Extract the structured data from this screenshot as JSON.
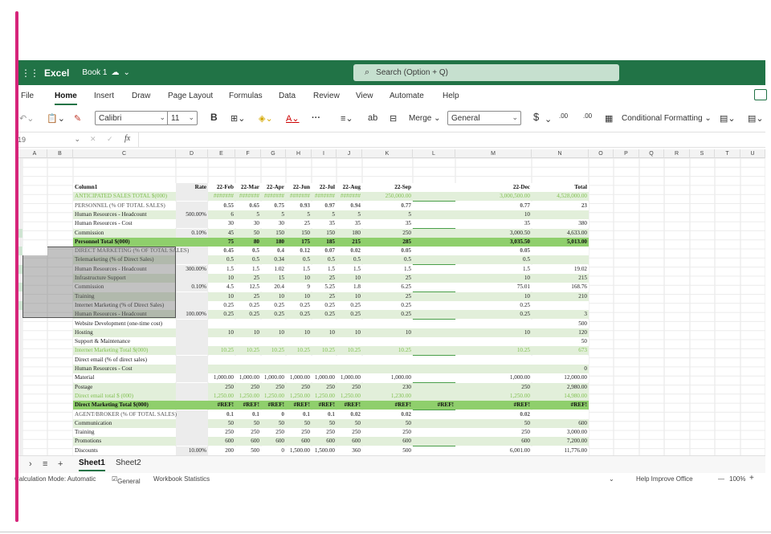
{
  "app": {
    "name": "Excel",
    "book": "Book 1"
  },
  "search": {
    "placeholder": "Search (Option + Q)"
  },
  "menu": [
    "File",
    "Home",
    "Insert",
    "Draw",
    "Page Layout",
    "Formulas",
    "Data",
    "Review",
    "View",
    "Automate",
    "Help"
  ],
  "toolbar": {
    "font": "Calibri",
    "size": "11",
    "bold": "B",
    "font_color": "A",
    "more": "···",
    "merge": "Merge",
    "number_format": "General",
    "currency": "$",
    "dec_inc": ".00",
    "dec_dec": ".00",
    "cond_format": "Conditional Formatting"
  },
  "formula_bar": {
    "namebox": "19",
    "cancel": "✕",
    "confirm": "✓",
    "fx": "fx"
  },
  "columns": [
    "A",
    "B",
    "C",
    "D",
    "E",
    "F",
    "G",
    "H",
    "I",
    "J",
    "K",
    "L",
    "M",
    "N",
    "O",
    "P",
    "Q",
    "R",
    "S",
    "T",
    "U"
  ],
  "rows": [
    {
      "c": "Column1",
      "d": "Rate",
      "e": "22-Feb",
      "f": "22-Mar",
      "g": "22-Apr",
      "h": "22-Jun",
      "i": "22-Jul",
      "j": "22-Aug",
      "k": "22-Sep",
      "m": "22-Dec",
      "n": "Total",
      "style": "header"
    },
    {
      "c": "ANTICIPATED SALES TOTAL $(000)",
      "e": "#######",
      "f": "#######",
      "g": "#######",
      "h": "#######",
      "i": "#######",
      "j": "#######",
      "k": "250,000.00",
      "m": "3,000,500.00",
      "n": "4,528,000.00",
      "style": "greentext"
    },
    {
      "c": "PERSONNEL (% OF TOTAL SALES)",
      "e": "0.55",
      "f": "0.65",
      "g": "0.75",
      "h": "0.93",
      "i": "0.97",
      "j": "0.94",
      "k": "0.77",
      "m": "0.77",
      "n": "23",
      "style": "boldnum"
    },
    {
      "c": "Human Resources - Headcount",
      "d": "500.00%",
      "e": "6",
      "f": "5",
      "g": "5",
      "h": "5",
      "i": "5",
      "j": "5",
      "k": "5",
      "m": "10",
      "n": "",
      "style": "light"
    },
    {
      "c": "Human Resources - Cost",
      "e": "30",
      "f": "30",
      "g": "30",
      "h": "25",
      "i": "35",
      "j": "35",
      "k": "35",
      "m": "35",
      "n": "380",
      "style": "plain"
    },
    {
      "c": "Commission",
      "d": "0.10%",
      "e": "45",
      "f": "50",
      "g": "150",
      "h": "150",
      "i": "150",
      "j": "180",
      "k": "250",
      "m": "3,000.50",
      "n": "4,633.00",
      "style": "light"
    },
    {
      "c": "Personnel Total $(000)",
      "e": "75",
      "f": "80",
      "g": "180",
      "h": "175",
      "i": "185",
      "j": "215",
      "k": "285",
      "m": "3,035.50",
      "n": "5,013.00",
      "style": "total"
    },
    {
      "c": "DIRECT MARKETING (% OF TOTAL SALES)",
      "e": "0.45",
      "f": "0.5",
      "g": "0.4",
      "h": "0.12",
      "i": "0.07",
      "j": "0.02",
      "k": "0.05",
      "m": "0.05",
      "n": "",
      "style": "boldnum"
    },
    {
      "c": "Telemarketing (% of Direct Sales)",
      "e": "0.5",
      "f": "0.5",
      "g": "0.34",
      "h": "0.5",
      "i": "0.5",
      "j": "0.5",
      "k": "0.5",
      "m": "0.5",
      "n": "",
      "style": "light"
    },
    {
      "c": "Human Resources - Headcount",
      "d": "300.00%",
      "e": "1.5",
      "f": "1.5",
      "g": "1.02",
      "h": "1.5",
      "i": "1.5",
      "j": "1.5",
      "k": "1.5",
      "m": "1.5",
      "n": "19.02",
      "style": "plain"
    },
    {
      "c": "Infrastructure Support",
      "e": "10",
      "f": "25",
      "g": "15",
      "h": "10",
      "i": "25",
      "j": "10",
      "k": "25",
      "m": "10",
      "n": "215",
      "style": "light"
    },
    {
      "c": "Commission",
      "d": "0.10%",
      "e": "4.5",
      "f": "12.5",
      "g": "20.4",
      "h": "9",
      "i": "5.25",
      "j": "1.8",
      "k": "6.25",
      "m": "75.01",
      "n": "168.76",
      "style": "plain"
    },
    {
      "c": "Training",
      "e": "10",
      "f": "25",
      "g": "10",
      "h": "10",
      "i": "25",
      "j": "10",
      "k": "25",
      "m": "10",
      "n": "210",
      "style": "light"
    },
    {
      "c": "Internet Marketing (% of Direct Sales)",
      "e": "0.25",
      "f": "0.25",
      "g": "0.25",
      "h": "0.25",
      "i": "0.25",
      "j": "0.25",
      "k": "0.25",
      "m": "0.25",
      "n": "",
      "style": "plain"
    },
    {
      "c": "Human Resources - Headcount",
      "d": "100.00%",
      "e": "0.25",
      "f": "0.25",
      "g": "0.25",
      "h": "0.25",
      "i": "0.25",
      "j": "0.25",
      "k": "0.25",
      "m": "0.25",
      "n": "3",
      "style": "light"
    },
    {
      "c": "Website Development (one-time cost)",
      "n": "500",
      "style": "plain"
    },
    {
      "c": "Hosting",
      "e": "10",
      "f": "10",
      "g": "10",
      "h": "10",
      "i": "10",
      "j": "10",
      "k": "10",
      "m": "10",
      "n": "120",
      "style": "light"
    },
    {
      "c": "Support & Maintenance",
      "n": "50",
      "style": "plain"
    },
    {
      "c": "Internet Marketing Total $(000)",
      "e": "10.25",
      "f": "10.25",
      "g": "10.25",
      "h": "10.25",
      "i": "10.25",
      "j": "10.25",
      "k": "10.25",
      "m": "10.25",
      "n": "673",
      "style": "greentext"
    },
    {
      "c": "Direct email (% of direct sales)",
      "style": "plain"
    },
    {
      "c": "Human Resources - Cost",
      "n": "0",
      "style": "light"
    },
    {
      "c": "Material",
      "e": "1,000.00",
      "f": "1,000.00",
      "g": "1,000.00",
      "h": "1,000.00",
      "i": "1,000.00",
      "j": "1,000.00",
      "k": "1,000.00",
      "m": "1,000.00",
      "n": "12,000.00",
      "style": "plain"
    },
    {
      "c": "Postage",
      "e": "250",
      "f": "250",
      "g": "250",
      "h": "250",
      "i": "250",
      "j": "250",
      "k": "230",
      "m": "250",
      "n": "2,980.00",
      "style": "light"
    },
    {
      "c": "Direct email total $ (000)",
      "e": "1,250.00",
      "f": "1,250.00",
      "g": "1,250.00",
      "h": "1,250.00",
      "i": "1,250.00",
      "j": "1,250.00",
      "k": "1,230.00",
      "m": "1,250.00",
      "n": "14,980.00",
      "style": "greentext"
    },
    {
      "c": "Direct Marketing Total $(000)",
      "e": "#REF!",
      "f": "#REF!",
      "g": "#REF!",
      "h": "#REF!",
      "i": "#REF!",
      "j": "#REF!",
      "k": "#REF!",
      "l": "#REF!",
      "m": "#REF!",
      "n": "#REF!",
      "style": "total"
    },
    {
      "c": "AGENT/BROKER (% OF TOTAL SALES)",
      "e": "0.1",
      "f": "0.1",
      "g": "0",
      "h": "0.1",
      "i": "0.1",
      "j": "0.02",
      "k": "0.02",
      "m": "0.02",
      "n": "",
      "style": "boldnum"
    },
    {
      "c": "Communication",
      "e": "50",
      "f": "50",
      "g": "50",
      "h": "50",
      "i": "50",
      "j": "50",
      "k": "50",
      "m": "50",
      "n": "600",
      "style": "light"
    },
    {
      "c": "Training",
      "e": "250",
      "f": "250",
      "g": "250",
      "h": "250",
      "i": "250",
      "j": "250",
      "k": "250",
      "m": "250",
      "n": "3,000.00",
      "style": "plain"
    },
    {
      "c": "Promotions",
      "e": "600",
      "f": "600",
      "g": "600",
      "h": "600",
      "i": "600",
      "j": "600",
      "k": "600",
      "m": "600",
      "n": "7,200.00",
      "style": "light"
    },
    {
      "c": "Discounts",
      "d": "10.00%",
      "e": "200",
      "f": "500",
      "g": "0",
      "h": "1,500.00",
      "i": "1,500.00",
      "j": "360",
      "k": "500",
      "m": "6,001.00",
      "n": "11,776.00",
      "style": "plain"
    }
  ],
  "tabs": [
    "Sheet1",
    "Sheet2"
  ],
  "status": {
    "calc": "Calculation Mode: Automatic",
    "general": "General",
    "stats": "Workbook Statistics",
    "help": "Help Improve Office",
    "zoom_out": "—",
    "zoom": "100%",
    "zoom_in": "+"
  },
  "colors": {
    "excel_green": "#217346",
    "header_green": "#92d050",
    "light_green": "#e2efda",
    "total_green": "#70ad47",
    "green_col": "#4a9f4a",
    "green_text": "#7fbf4f"
  }
}
